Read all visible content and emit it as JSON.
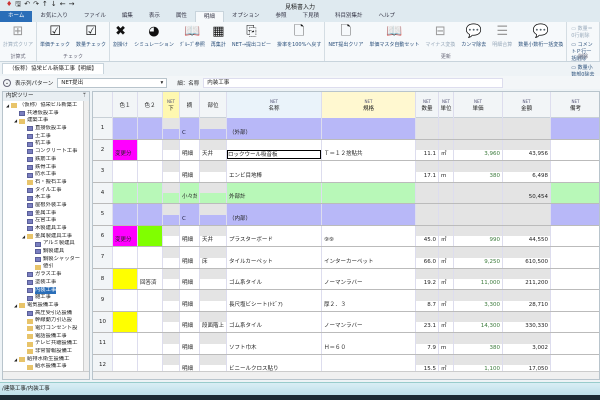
{
  "window": {
    "title": "見積書入力"
  },
  "quick_access": [
    "save-icon",
    "undo-icon",
    "redo-icon",
    "arrow-up-icon",
    "arrow-down-icon",
    "arrow-left-icon",
    "arrow-right-icon"
  ],
  "tabs": [
    "ホーム",
    "お気に入り",
    "ファイル",
    "編集",
    "表示",
    "属性",
    "明細",
    "オプション",
    "参照",
    "下見積",
    "科目別集計",
    "ヘルプ"
  ],
  "ribbon": {
    "groups": [
      {
        "label": "計算式",
        "buttons": [
          {
            "label": "計算式クリア",
            "icon": "calc-clear-icon",
            "glyph": "⊞",
            "disabled": true
          }
        ]
      },
      {
        "label": "チェック",
        "buttons": [
          {
            "label": "単価チェック",
            "icon": "check-icon",
            "glyph": "☑"
          },
          {
            "label": "数量チェック",
            "icon": "check-icon",
            "glyph": "☑"
          }
        ]
      },
      {
        "label": "",
        "buttons": [
          {
            "label": "割掛け",
            "icon": "x-icon",
            "glyph": "✖"
          },
          {
            "label": "シミュレーション",
            "icon": "pie-icon",
            "glyph": "◕"
          },
          {
            "label": "ｸﾞﾙｰﾌﾟ参照",
            "icon": "book-icon",
            "glyph": "📖"
          },
          {
            "label": "再集計",
            "icon": "calculator-icon",
            "glyph": "▦"
          },
          {
            "label": "NET→提出コピー",
            "icon": "doc-arrow-icon",
            "glyph": "⎘"
          },
          {
            "label": "掛率を100%へ戻す",
            "icon": "doc-x-icon",
            "glyph": "🗋"
          }
        ]
      },
      {
        "label": "更新",
        "buttons": [
          {
            "label": "NET提出クリア",
            "icon": "doc-x-icon",
            "glyph": "🗋"
          },
          {
            "label": "単価マスタ自動セット",
            "icon": "book-icon",
            "glyph": "📖"
          },
          {
            "label": "マイナス変換",
            "icon": "minus-box-icon",
            "glyph": "⊟",
            "disabled": true
          },
          {
            "label": "カンマ除去",
            "icon": "comment-x-icon",
            "glyph": "💬"
          },
          {
            "label": "明細合算",
            "icon": "list-icon",
            "glyph": "☰",
            "disabled": true
          },
          {
            "label": "数量小数桁一括変換",
            "icon": "comment-icon",
            "glyph": "💬"
          }
        ]
      }
    ],
    "delete_group": {
      "label": "削除",
      "items": [
        {
          "label": "数量＝0行削除",
          "disabled": true
        },
        {
          "label": "コメントＰ行一括削除"
        },
        {
          "label": "数量小数部0除去"
        }
      ]
    }
  },
  "document_tab": "（仮称）協栄ビル新築工事【明細】",
  "toolbar": {
    "pattern_label": "表示列パターン",
    "pattern_value": "NET提出",
    "field_label": "細：名称",
    "field_value": "内装工事"
  },
  "tree": {
    "title": "内訳ツリー",
    "pin": "ᛘ",
    "nodes": [
      {
        "label": "（仮称）協栄ビル新築工",
        "depth": 0,
        "type": "folder",
        "expanded": true
      },
      {
        "label": "共通仮設工事",
        "depth": 1,
        "type": "doc"
      },
      {
        "label": "建築工事",
        "depth": 1,
        "type": "folder",
        "expanded": true
      },
      {
        "label": "直接仮設工事",
        "depth": 2,
        "type": "doc"
      },
      {
        "label": "土工事",
        "depth": 2,
        "type": "doc"
      },
      {
        "label": "杭工事",
        "depth": 2,
        "type": "doc"
      },
      {
        "label": "コンクリート工事",
        "depth": 2,
        "type": "doc"
      },
      {
        "label": "鉄筋工事",
        "depth": 2,
        "type": "doc"
      },
      {
        "label": "鉄骨工事",
        "depth": 2,
        "type": "doc"
      },
      {
        "label": "防水工事",
        "depth": 2,
        "type": "doc"
      },
      {
        "label": "石・擬石工事",
        "depth": 2,
        "type": "folder"
      },
      {
        "label": "タイル工事",
        "depth": 2,
        "type": "doc"
      },
      {
        "label": "木工事",
        "depth": 2,
        "type": "doc"
      },
      {
        "label": "屋根外装工事",
        "depth": 2,
        "type": "doc"
      },
      {
        "label": "金属工事",
        "depth": 2,
        "type": "doc"
      },
      {
        "label": "左官工事",
        "depth": 2,
        "type": "doc"
      },
      {
        "label": "木製建具工事",
        "depth": 2,
        "type": "doc"
      },
      {
        "label": "金属製建具工事",
        "depth": 2,
        "type": "folder",
        "expanded": true
      },
      {
        "label": "アルミ製建具",
        "depth": 3,
        "type": "doc"
      },
      {
        "label": "鋼製建具",
        "depth": 3,
        "type": "doc"
      },
      {
        "label": "鋼製シャッター",
        "depth": 3,
        "type": "doc"
      },
      {
        "label": "値引",
        "depth": 3,
        "type": "folder"
      },
      {
        "label": "ガラス工事",
        "depth": 2,
        "type": "doc"
      },
      {
        "label": "塗装工事",
        "depth": 2,
        "type": "doc"
      },
      {
        "label": "内装工事",
        "depth": 2,
        "type": "doc",
        "selected": true
      },
      {
        "label": "雑工事",
        "depth": 2,
        "type": "doc"
      },
      {
        "label": "電気設備工事",
        "depth": 1,
        "type": "folder",
        "expanded": true
      },
      {
        "label": "高圧受引込設備",
        "depth": 2,
        "type": "doc"
      },
      {
        "label": "幹線動力引込設",
        "depth": 2,
        "type": "folder"
      },
      {
        "label": "電灯コンセント設",
        "depth": 2,
        "type": "folder"
      },
      {
        "label": "電話設備工事",
        "depth": 2,
        "type": "folder"
      },
      {
        "label": "テレビ共聴設備工",
        "depth": 2,
        "type": "folder"
      },
      {
        "label": "非常警報設備工",
        "depth": 2,
        "type": "folder"
      },
      {
        "label": "給排水衛生設備工",
        "depth": 1,
        "type": "folder",
        "expanded": true
      },
      {
        "label": "給水設備工事",
        "depth": 2,
        "type": "folder"
      }
    ]
  },
  "grid": {
    "columns": [
      {
        "key": "c1",
        "label": "色１",
        "sub": ""
      },
      {
        "key": "c2",
        "label": "色２",
        "sub": ""
      },
      {
        "key": "nd",
        "label": "下",
        "sub": "NET"
      },
      {
        "key": "tk",
        "label": "摘",
        "sub": ""
      },
      {
        "key": "bui",
        "label": "部位",
        "sub": ""
      },
      {
        "key": "name",
        "label": "名称",
        "sub": "NET"
      },
      {
        "key": "spec",
        "label": "規格",
        "sub": "NET"
      },
      {
        "key": "qty",
        "label": "数量",
        "sub": "NET"
      },
      {
        "key": "unit",
        "label": "単位",
        "sub": "NET"
      },
      {
        "key": "price",
        "label": "単価",
        "sub": "NET"
      },
      {
        "key": "amt",
        "label": "金額",
        "sub": "NET"
      },
      {
        "key": "note",
        "label": "備考",
        "sub": "NET"
      }
    ],
    "colors": {
      "section": "#b8b8f8",
      "subtotal": "#b8f8b8",
      "magenta": "#ff00ff",
      "lime": "#80ff00",
      "yellow": "#ffff00"
    },
    "rows": [
      {
        "no": "1",
        "kind": "section",
        "tk": "C",
        "name": "（外部）"
      },
      {
        "no": "2",
        "c1": "変更分",
        "c1color": "magenta",
        "tk": "明細",
        "bui": "天井",
        "name": "ロックウール吸音板",
        "spec": "Ｔ＝１２捨貼共",
        "qty": "11.1",
        "unit": "㎡",
        "price": "3,960",
        "amt": "43,956",
        "selected": true
      },
      {
        "no": "3",
        "tk": "明細",
        "name": "エンビ目地棒",
        "qty": "17.1",
        "unit": "m",
        "price": "380",
        "amt": "6,498"
      },
      {
        "no": "4",
        "kind": "subtotal",
        "tk": "小々計",
        "name": "外部計",
        "amt": "50,454"
      },
      {
        "no": "5",
        "kind": "section",
        "tk": "C",
        "name": "（内部）"
      },
      {
        "no": "6",
        "c1": "変更分",
        "c1color": "magenta",
        "c2color": "lime",
        "tk": "明細",
        "bui": "天井",
        "name": "プラスターボード",
        "spec": "⑨⑨",
        "qty": "45.0",
        "unit": "㎡",
        "price": "990",
        "amt": "44,550"
      },
      {
        "no": "7",
        "tk": "明細",
        "bui": "床",
        "name": "タイルカーペット",
        "spec": "インターカーペット",
        "qty": "66.0",
        "unit": "㎡",
        "price": "9,250",
        "amt": "610,500"
      },
      {
        "no": "8",
        "c1color": "yellow",
        "c2": "回答済",
        "tk": "明細",
        "name": "ゴム系タイル",
        "spec": "ノーマンラバー",
        "qty": "19.2",
        "unit": "㎡",
        "price": "11,000",
        "amt": "211,200"
      },
      {
        "no": "9",
        "tk": "明細",
        "name": "長尺塩ビシート(ﾄﾋﾞｱ)",
        "spec": "厚２．３",
        "qty": "8.7",
        "unit": "㎡",
        "price": "3,300",
        "amt": "28,710"
      },
      {
        "no": "10",
        "c1color": "yellow",
        "tk": "明細",
        "bui": "段面階上",
        "name": "ゴム系タイル",
        "spec": "ノーマンラバー",
        "qty": "23.1",
        "unit": "㎡",
        "price": "14,300",
        "amt": "330,330"
      },
      {
        "no": "11",
        "tk": "明細",
        "name": "ソフト巾木",
        "spec": "Ｈ＝６０",
        "qty": "7.9",
        "unit": "m",
        "price": "380",
        "amt": "3,002"
      },
      {
        "no": "12",
        "tk": "明細",
        "name": "ビニールクロス貼り",
        "qty": "15.5",
        "unit": "㎡",
        "price": "1,100",
        "amt": "17,050"
      }
    ]
  },
  "status": {
    "path": "/建築工事/内装工事"
  }
}
